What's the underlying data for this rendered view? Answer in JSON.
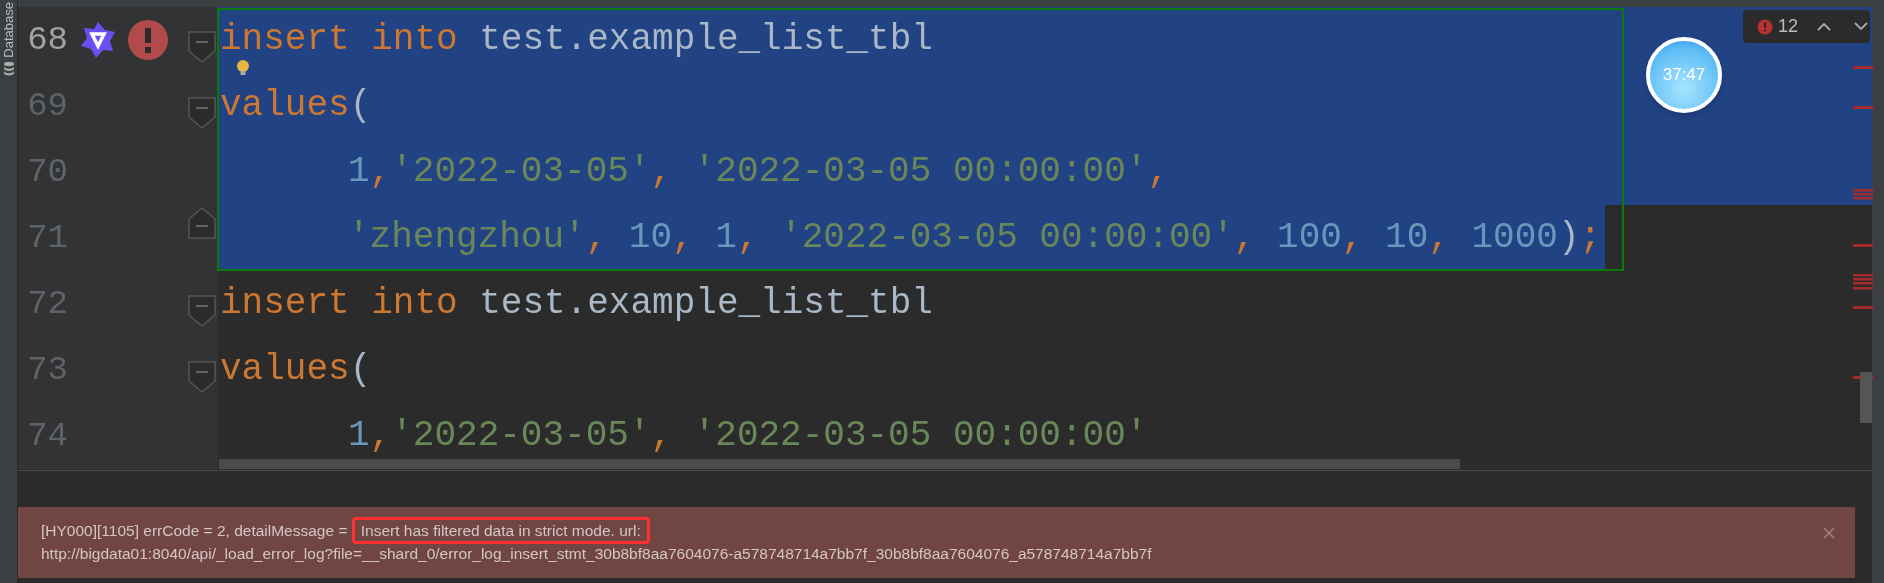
{
  "side_tab": {
    "label": "Database"
  },
  "error_counter": {
    "count": "12"
  },
  "timer": {
    "time": "37:47"
  },
  "code_lines": [
    {
      "number": "68",
      "current": true,
      "fold": {
        "kind": "start"
      },
      "selected": true,
      "indented": false,
      "markers": [
        {
          "kind": "ai"
        },
        {
          "kind": "error"
        }
      ],
      "tokens": [
        {
          "kind": "keyword",
          "text": "insert into"
        },
        {
          "kind": "plain",
          "text": " test.example_list_tbl"
        }
      ]
    },
    {
      "number": "69",
      "current": false,
      "fold": {
        "kind": "start"
      },
      "selected": true,
      "indented": false,
      "markers": [
        {
          "kind": "bulb"
        }
      ],
      "tokens": [
        {
          "kind": "keyword",
          "text": "values"
        },
        {
          "kind": "plain",
          "text": "("
        }
      ]
    },
    {
      "number": "70",
      "current": false,
      "selected": true,
      "indented": true,
      "tokens": [
        {
          "kind": "number",
          "text": "1"
        },
        {
          "kind": "keyword",
          "text": ","
        },
        {
          "kind": "string",
          "text": "'2022-03-05'"
        },
        {
          "kind": "keyword",
          "text": ", "
        },
        {
          "kind": "string",
          "text": "'2022-03-05 00:00:00'"
        },
        {
          "kind": "keyword",
          "text": ","
        }
      ]
    },
    {
      "number": "71",
      "current": false,
      "fold": {
        "kind": "end"
      },
      "selected": true,
      "indented": true,
      "tokens": [
        {
          "kind": "string",
          "text": "'zhengzhou'"
        },
        {
          "kind": "keyword",
          "text": ", "
        },
        {
          "kind": "number",
          "text": "10"
        },
        {
          "kind": "keyword",
          "text": ", "
        },
        {
          "kind": "number",
          "text": "1"
        },
        {
          "kind": "keyword",
          "text": ", "
        },
        {
          "kind": "string",
          "text": "'2022-03-05 00:00:00'"
        },
        {
          "kind": "keyword",
          "text": ", "
        },
        {
          "kind": "number",
          "text": "100"
        },
        {
          "kind": "keyword",
          "text": ", "
        },
        {
          "kind": "number",
          "text": "10"
        },
        {
          "kind": "keyword",
          "text": ", "
        },
        {
          "kind": "number",
          "text": "1000"
        },
        {
          "kind": "plain",
          "text": ")"
        },
        {
          "kind": "keyword",
          "text": ";"
        }
      ]
    },
    {
      "number": "72",
      "current": false,
      "fold": {
        "kind": "start"
      },
      "selected": false,
      "indented": false,
      "tokens": [
        {
          "kind": "keyword",
          "text": "insert into"
        },
        {
          "kind": "plain",
          "text": " test.example_list_tbl"
        }
      ]
    },
    {
      "number": "73",
      "current": false,
      "fold": {
        "kind": "start"
      },
      "selected": false,
      "indented": false,
      "tokens": [
        {
          "kind": "keyword",
          "text": "values"
        },
        {
          "kind": "plain",
          "text": "("
        }
      ]
    },
    {
      "number": "74",
      "current": false,
      "selected": false,
      "indented": true,
      "tokens": [
        {
          "kind": "number",
          "text": "1"
        },
        {
          "kind": "keyword",
          "text": ","
        },
        {
          "kind": "string",
          "text": "'2022-03-05'"
        },
        {
          "kind": "keyword",
          "text": ", "
        },
        {
          "kind": "string",
          "text": "'2022-03-05 00:00:00'"
        }
      ]
    }
  ],
  "error_message": {
    "text": "[HY000][1105] errCode = 2, detailMessage = ",
    "highlighted": "Insert has filtered data in strict mode. url:",
    "url": "http://bigdata01:8040/api/_load_error_log?file=__shard_0/error_log_insert_stmt_30b8bf8aa7604076-a578748714a7bb7f_30b8bf8aa7604076_a578748714a7bb7f"
  }
}
